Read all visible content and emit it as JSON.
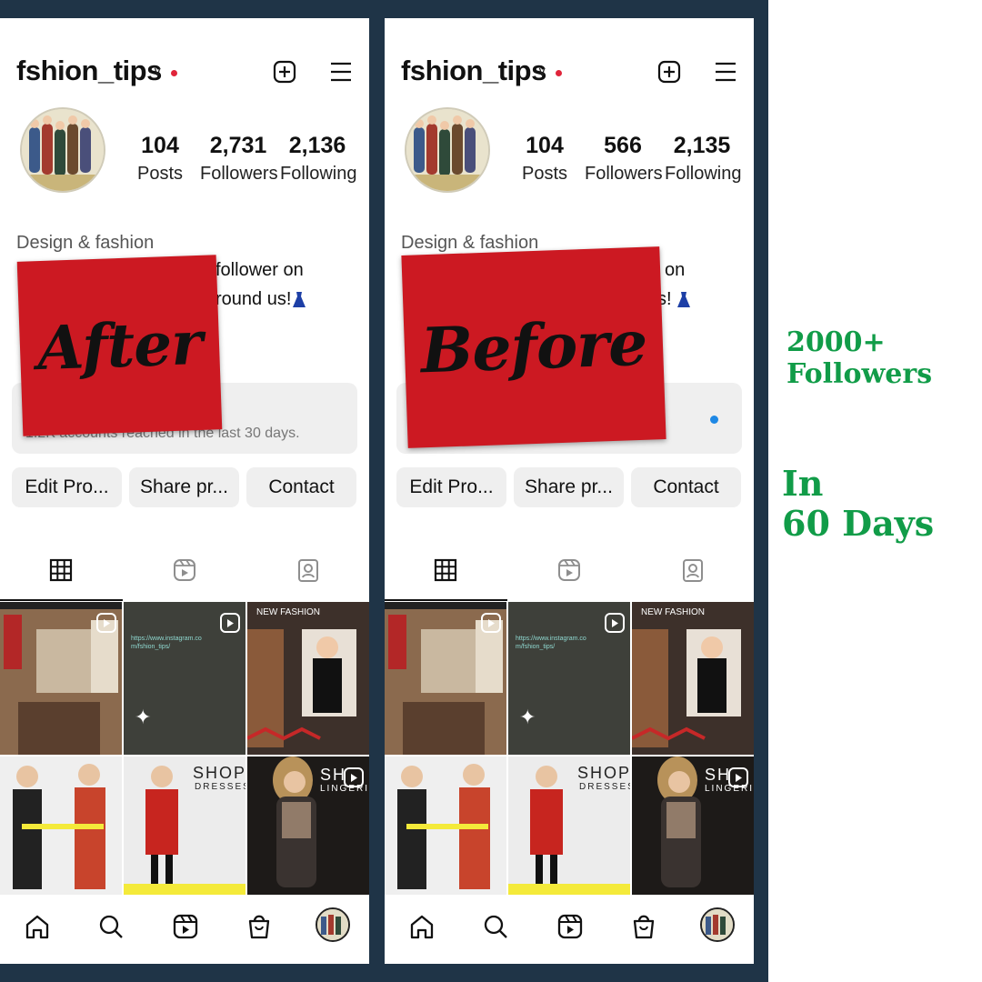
{
  "colors": {
    "frame": "#1f3447",
    "sticker": "#cc1922",
    "promo": "#119c48",
    "notification_dot": "#e0243a",
    "link_blue": "#1e88e5"
  },
  "after": {
    "username": "fshion_tips",
    "stats": {
      "posts": "104",
      "posts_label": "Posts",
      "followers": "2,731",
      "followers_label": "Followers",
      "following": "2,136",
      "following_label": "Following"
    },
    "bio": {
      "category": "Design & fashion",
      "line1": "follower on",
      "line2": "round us!"
    },
    "dashboard_text": "1.2K accounts reached in the last 30 days.",
    "buttons": {
      "edit": "Edit Pro...",
      "share": "Share pr...",
      "contact": "Contact"
    },
    "sticker": "After"
  },
  "before": {
    "username": "fshion_tips",
    "stats": {
      "posts": "104",
      "posts_label": "Posts",
      "followers": "566",
      "followers_label": "Followers",
      "following": "2,135",
      "following_label": "Following"
    },
    "bio": {
      "category": "Design & fashion",
      "line1": "on",
      "line2": "s!"
    },
    "buttons": {
      "edit": "Edit Pro...",
      "share": "Share pr...",
      "contact": "Contact"
    },
    "sticker": "Before"
  },
  "grid_posts": {
    "link_post": "https://www.instagram.co m/fshion_tips/",
    "new_fashion": "NEW FASHION",
    "shop": "SHOP",
    "dresses": "DRESSES",
    "sh": "SH",
    "lingerie": "LINGERIE"
  },
  "icons": {
    "header": [
      "plus-square-icon",
      "menu-icon"
    ],
    "tabs": [
      "grid-icon",
      "reels-icon",
      "tagged-icon"
    ],
    "nav": [
      "home-icon",
      "search-icon",
      "reels-icon",
      "shop-icon",
      "profile-avatar"
    ]
  },
  "promo": {
    "line1": "2000+",
    "line2": "Followers",
    "line3": "In",
    "line4": "60 Days"
  }
}
